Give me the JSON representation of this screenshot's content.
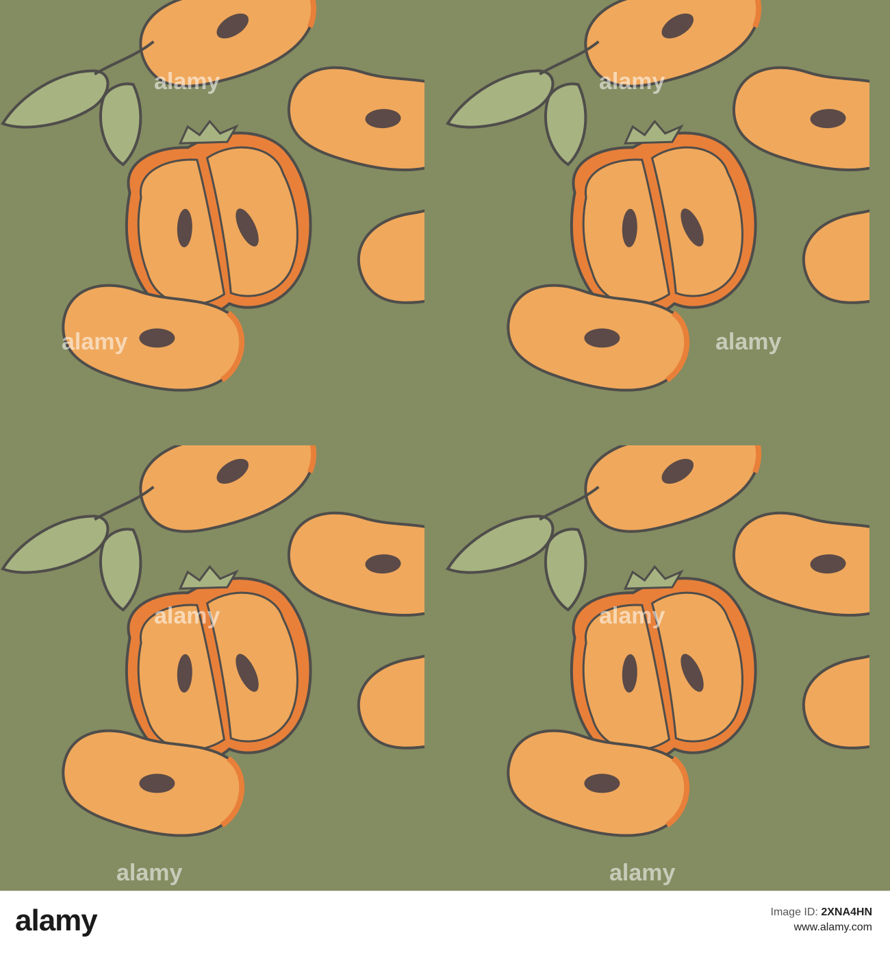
{
  "watermark": {
    "text": "alamy"
  },
  "footer": {
    "logo": "alamy",
    "image_id_label": "Image ID:",
    "image_id": "2XNA4HN",
    "site": "www.alamy.com"
  },
  "colors": {
    "background": "#848c62",
    "fruit_outer": "#e8803a",
    "fruit_flesh": "#f0a85c",
    "seed": "#5b4a47",
    "leaf": "#a7b381",
    "outline": "#4f4d4a"
  },
  "motifs": {
    "tile_content": [
      "persimmon-half",
      "persimmon-slice",
      "persimmon-slice",
      "leaf-sprig"
    ]
  }
}
